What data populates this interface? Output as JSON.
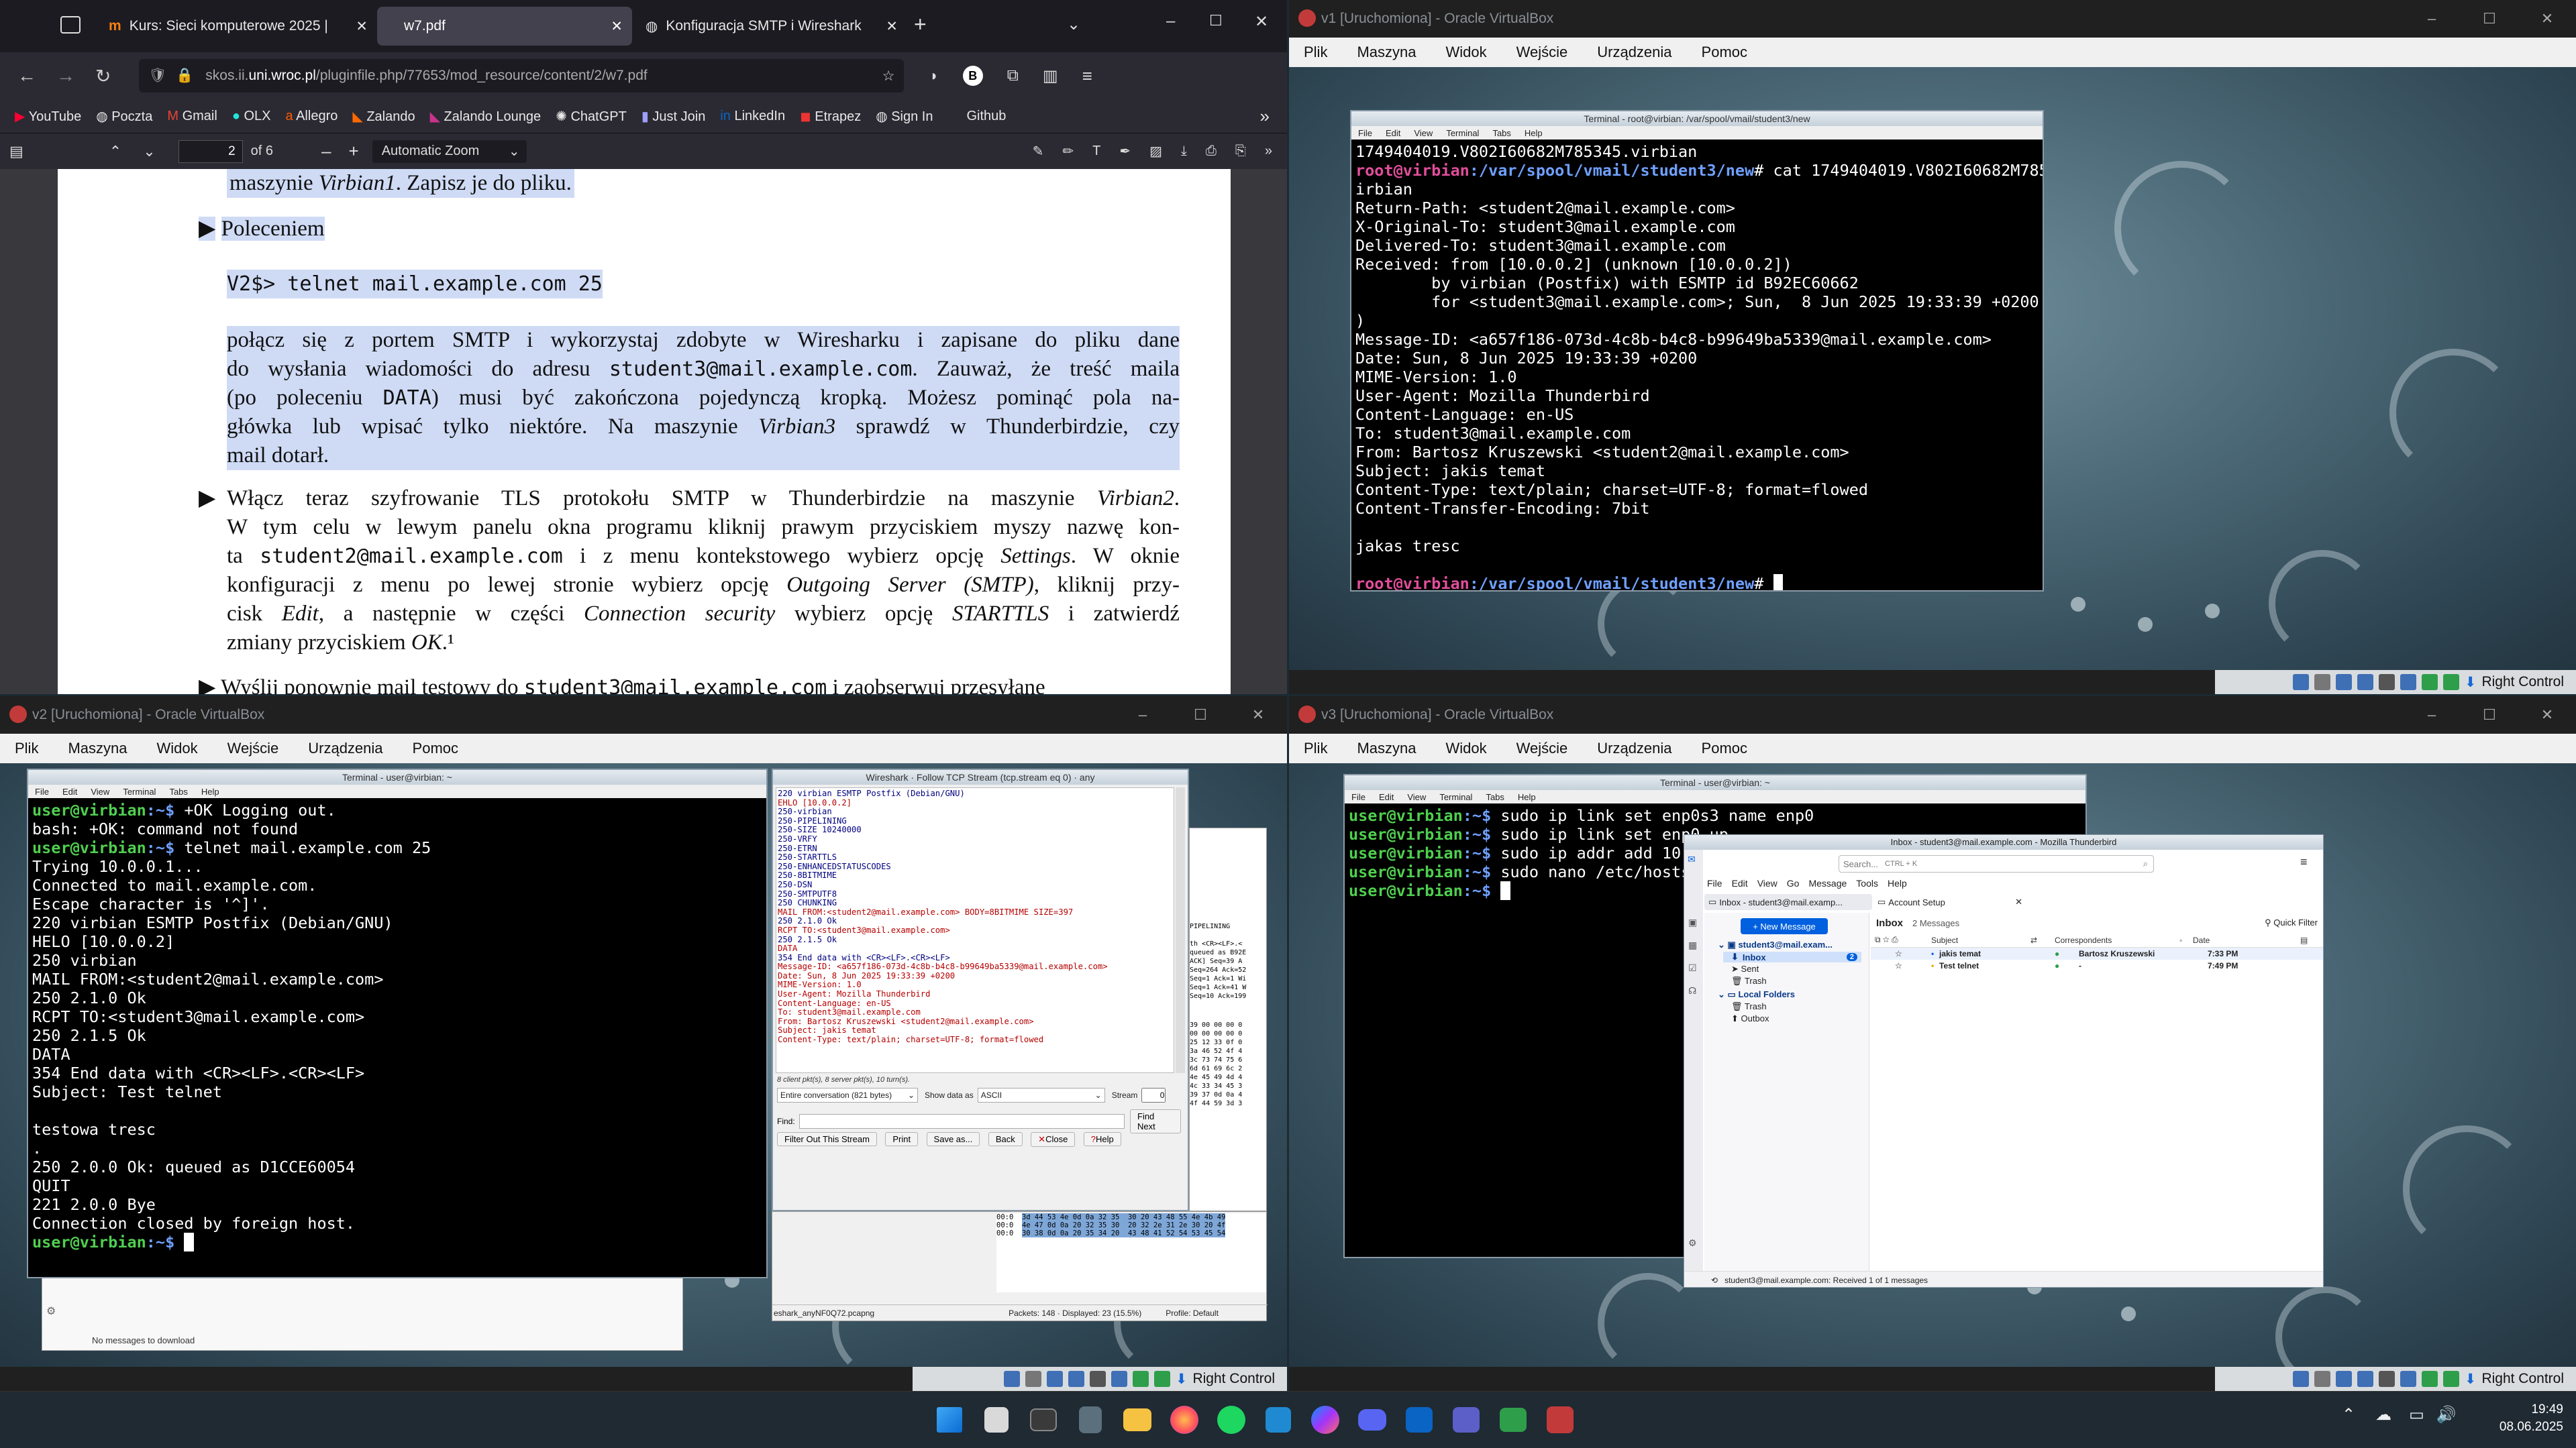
{
  "browser": {
    "tabs": [
      {
        "label": "Kurs: Sieci komputerowe 2025 |"
      },
      {
        "label": "w7.pdf"
      },
      {
        "label": "Konfiguracja SMTP i Wireshark"
      }
    ],
    "url_prefix": "skos.ii.",
    "url_domain": "uni.wroc.pl",
    "url_path": "/pluginfile.php/77653/mod_resource/content/2/w7.pdf",
    "bookmarks": [
      "YouTube",
      "Poczta",
      "Gmail",
      "OLX",
      "Allegro",
      "Zalando",
      "Zalando Lounge",
      "ChatGPT",
      "Just Join",
      "LinkedIn",
      "Etrapez",
      "Sign In",
      "Github"
    ],
    "pdf": {
      "page": "2",
      "of": "of 6",
      "zoom": "Automatic Zoom"
    }
  },
  "document": {
    "l1a": "maszynie ",
    "l1b": "Virbian1",
    "l1c": ". Zapisz je do pliku.",
    "b1": "Poleceniem",
    "cmd": "V2$> telnet mail.example.com 25",
    "p1a": "połącz się z portem SMTP i wykorzystaj zdobyte w Wiresharku i zapisane do pliku dane",
    "p1b": "do wysłania wiadomości do adresu ",
    "p1b_code": "student3@mail.example.com",
    "p1b_end": ". Zauważ, że treść maila",
    "p1c_start": "(po poleceniu ",
    "p1c_code": "DATA",
    "p1c_end": ") musi być zakończona pojedynczą kropką. Możesz pominąć pola na-",
    "p1d": "główka lub wpisać tylko niektóre. Na maszynie ",
    "p1d_em": "Virbian3",
    "p1d_end": " sprawdź w Thunderbirdzie, czy",
    "p1e": "mail dotarł.",
    "b2a": "Włącz teraz szyfrowanie TLS protokołu SMTP w Thunderbirdzie na maszynie ",
    "b2a_em": "Virbian2",
    "b2a_end": ".",
    "b2b": "W tym celu w lewym panelu okna programu kliknij prawym przyciskiem myszy nazwę kon-",
    "b2c_start": "ta ",
    "b2c_code": "student2@mail.example.com",
    "b2c_mid": " i z menu kontekstowego wybierz opcję ",
    "b2c_em": "Settings",
    "b2c_end": ". W oknie",
    "b2d": "konfiguracji z menu po lewej stronie wybierz opcję ",
    "b2d_em": "Outgoing Server (SMTP)",
    "b2d_end": ", kliknij przy-",
    "b2e": "cisk ",
    "b2e_em": "Edit",
    "b2e_mid": ", a następnie w części ",
    "b2e_em2": "Connection security",
    "b2e_mid2": " wybierz opcję ",
    "b2e_em3": "STARTTLS",
    "b2e_end": " i zatwierdź",
    "b2f": "zmiany przyciskiem ",
    "b2f_em": "OK",
    "b2f_end": ".¹",
    "b3a": "Wyślij ponownie mail testowy do ",
    "b3a_code": "student3@mail.example.com",
    "b3a_end": " i zaobserwuj przesyłane"
  },
  "vm1": {
    "title": "v1 [Uruchomiona] - Oracle VirtualBox",
    "menu": [
      "Plik",
      "Maszyna",
      "Widok",
      "Wejście",
      "Urządzenia",
      "Pomoc"
    ],
    "host_key": "Right Control"
  },
  "vm1_term": {
    "title": "Terminal - root@virbian: /var/spool/vmail/student3/new",
    "menu": [
      "File",
      "Edit",
      "View",
      "Terminal",
      "Tabs",
      "Help"
    ],
    "line_0": "1749404019.V802I60682M785345.virbian",
    "prompt": "root@virbian",
    "path": ":/var/spool/vmail/student3/new",
    "cmd1": "# cat 1749404019.V802I60682M785345.v",
    "out": [
      "irbian",
      "Return-Path: <student2@mail.example.com>",
      "X-Original-To: student3@mail.example.com",
      "Delivered-To: student3@mail.example.com",
      "Received: from [10.0.0.2] (unknown [10.0.0.2])",
      "        by virbian (Postfix) with ESMTP id B92EC60662",
      "        for <student3@mail.example.com>; Sun,  8 Jun 2025 19:33:39 +0200 (CEST",
      ")",
      "Message-ID: <a657f186-073d-4c8b-b4c8-b99649ba5339@mail.example.com>",
      "Date: Sun, 8 Jun 2025 19:33:39 +0200",
      "MIME-Version: 1.0",
      "User-Agent: Mozilla Thunderbird",
      "Content-Language: en-US",
      "To: student3@mail.example.com",
      "From: Bartosz Kruszewski <student2@mail.example.com>",
      "Subject: jakis temat",
      "Content-Type: text/plain; charset=UTF-8; format=flowed",
      "Content-Transfer-Encoding: 7bit",
      "",
      "jakas tresc",
      ""
    ],
    "end": "#"
  },
  "vm2": {
    "title": "v2 [Uruchomiona] - Oracle VirtualBox",
    "host_key": "Right Control",
    "tb_status": "No messages to download"
  },
  "vm2_term": {
    "title": "Terminal - user@virbian: ~",
    "prompt": "user@virbian",
    "tilde": ":~$",
    "l0": " +OK Logging out.",
    "l1": "bash: +OK: command not found",
    "l2": " telnet mail.example.com 25",
    "out": [
      "Trying 10.0.0.1...",
      "Connected to mail.example.com.",
      "Escape character is '^]'.",
      "220 virbian ESMTP Postfix (Debian/GNU)",
      "HELO [10.0.0.2]",
      "250 virbian",
      "MAIL FROM:<student2@mail.example.com>",
      "250 2.1.0 Ok",
      "RCPT TO:<student3@mail.example.com>",
      "250 2.1.5 Ok",
      "DATA",
      "354 End data with <CR><LF>.<CR><LF>",
      "Subject: Test telnet",
      "",
      "testowa tresc",
      ".",
      "250 2.0.0 Ok: queued as D1CCE60054",
      "QUIT",
      "221 2.0.0 Bye",
      "Connection closed by foreign host."
    ]
  },
  "wireshark": {
    "title": "Wireshark · Follow TCP Stream (tcp.stream eq 0) · any",
    "lines": [
      [
        "s",
        "220 virbian ESMTP Postfix (Debian/GNU)"
      ],
      [
        "c",
        "EHLO [10.0.0.2]"
      ],
      [
        "s",
        "250-virbian"
      ],
      [
        "s",
        "250-PIPELINING"
      ],
      [
        "s",
        "250-SIZE 10240000"
      ],
      [
        "s",
        "250-VRFY"
      ],
      [
        "s",
        "250-ETRN"
      ],
      [
        "s",
        "250-STARTTLS"
      ],
      [
        "s",
        "250-ENHANCEDSTATUSCODES"
      ],
      [
        "s",
        "250-8BITMIME"
      ],
      [
        "s",
        "250-DSN"
      ],
      [
        "s",
        "250-SMTPUTF8"
      ],
      [
        "s",
        "250 CHUNKING"
      ],
      [
        "c",
        "MAIL FROM:<student2@mail.example.com> BODY=8BITMIME SIZE=397"
      ],
      [
        "s",
        "250 2.1.0 Ok"
      ],
      [
        "c",
        "RCPT TO:<student3@mail.example.com>"
      ],
      [
        "s",
        "250 2.1.5 Ok"
      ],
      [
        "c",
        "DATA"
      ],
      [
        "s",
        "354 End data with <CR><LF>.<CR><LF>"
      ],
      [
        "c",
        "Message-ID: <a657f186-073d-4c8b-b4c8-b99649ba5339@mail.example.com>"
      ],
      [
        "c",
        "Date: Sun, 8 Jun 2025 19:33:39 +0200"
      ],
      [
        "c",
        "MIME-Version: 1.0"
      ],
      [
        "c",
        "User-Agent: Mozilla Thunderbird"
      ],
      [
        "c",
        "Content-Language: en-US"
      ],
      [
        "c",
        "To: student3@mail.example.com"
      ],
      [
        "c",
        "From: Bartosz Kruszewski <student2@mail.example.com>"
      ],
      [
        "c",
        "Subject: jakis temat"
      ],
      [
        "c",
        "Content-Type: text/plain; charset=UTF-8; format=flowed"
      ]
    ],
    "summary": "8 client pkt(s), 8 server pkt(s), 10 turn(s).",
    "conv": "Entire conversation (821 bytes)",
    "show_as_label": "Show data as",
    "show_as": "ASCII",
    "stream_label": "Stream",
    "stream": "0",
    "find_label": "Find:",
    "find_next": "Find Next",
    "buttons": [
      "Filter Out This Stream",
      "Print",
      "Save as...",
      "Back",
      "Close",
      "Help"
    ],
    "status_file": "eshark_anyNF0Q72.pcapng",
    "status_packets": "Packets: 148 · Displayed: 23 (15.5%)",
    "status_profile": "Profile: Default",
    "side_lines": [
      "PIPELINING",
      "",
      "th <CR><LF>.<",
      "queued as B92E",
      "ACK] Seq=39 A",
      "Seq=264 Ack=52",
      "Seq=1 Ack=1 Wi",
      "Seq=1 Ack=41 W",
      "Seq=10 Ack=199"
    ],
    "hex_rows": [
      "39 00 00 00 0",
      "00 00 00 00 0",
      "25 12 33 0f 0",
      "3a 46 52 4f 4",
      "3c 73 74 75 6",
      "6d 61 69 6c 2",
      "4e 45 49 4d 4",
      "4c 33 34 45 3",
      "39 37 0d 0a 4",
      "4f 44 59 3d 3"
    ],
    "hex_more": [
      [
        "00:0",
        "3d 44 53 4e 0d 0a 32 35  30 20 43 48 55 4e 4b 49"
      ],
      [
        "00:0",
        "4e 47 0d 0a 20 32 35 30  20 32 2e 31 2e 30 20 4f"
      ],
      [
        "00:0",
        "30 38 0d 0a 20 35 34 20  43 48 41 52 54 53 45 54"
      ]
    ]
  },
  "vm3": {
    "title": "v3 [Uruchomiona] - Oracle VirtualBox",
    "host_key": "Right Control"
  },
  "vm3_term": {
    "title": "Terminal - user@virbian: ~",
    "prompt": "user@virbian",
    "tilde": ":~$",
    "cmds": [
      " sudo ip link set enp0s3 name enp0",
      " sudo ip link set enp0 up",
      " sudo ip addr add 10.",
      " sudo nano /etc/hosts",
      ""
    ]
  },
  "thunderbird": {
    "title": "Inbox - student3@mail.example.com - Mozilla Thunderbird",
    "search": "Search...",
    "search_kbd": "CTRL + K",
    "menu": [
      "File",
      "Edit",
      "View",
      "Go",
      "Message",
      "Tools",
      "Help"
    ],
    "tab1": "Inbox - student3@mail.examp...",
    "tab2": "Account Setup",
    "new_message": "+ New Message",
    "account": "student3@mail.exam...",
    "folders": [
      "Inbox",
      "Sent",
      "Trash"
    ],
    "inbox_count": "2",
    "local": "Local Folders",
    "local_folders": [
      "Trash",
      "Outbox"
    ],
    "pane_title": "Inbox",
    "pane_count": "2 Messages",
    "quick_filter": "Quick Filter",
    "cols": [
      "Subject",
      "Correspondents",
      "Date"
    ],
    "rows": [
      {
        "subject": "jakis temat",
        "from": "Bartosz Kruszewski",
        "date": "7:33 PM"
      },
      {
        "subject": "Test telnet",
        "from": "-",
        "date": "7:49 PM"
      }
    ],
    "status": "student3@mail.example.com: Received 1 of 1 messages"
  },
  "taskbar": {
    "time": "19:49",
    "date": "08.06.2025"
  }
}
